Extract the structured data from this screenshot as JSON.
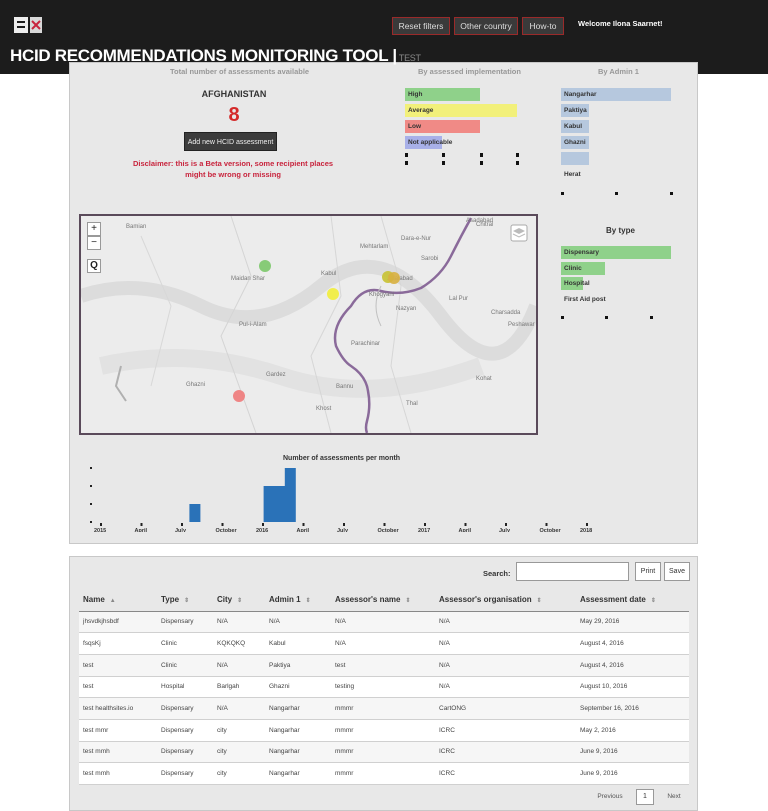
{
  "header": {
    "title": "HCID RECOMMENDATIONS MONITORING TOOL |",
    "title_suffix": "TEST",
    "nav": {
      "reset": "Reset filters",
      "other_country": "Other country",
      "howto": "How-to"
    },
    "welcome": "Welcome Ilona Saarnet!"
  },
  "summary": {
    "country": "AFGHANISTAN",
    "count": "8",
    "add_button": "Add new HCID assessment",
    "disclaimer": "Disclaimer: this is a Beta version, some recipient places might be wrong or missing",
    "faded_left": "Total number of assessments available",
    "faded_mid": "By assessed implementation",
    "faded_right": "By Admin 1"
  },
  "implementation": {
    "bars": [
      {
        "label": "High",
        "value": 2,
        "color": "#8fd18a"
      },
      {
        "label": "Average",
        "value": 3,
        "color": "#f2f07a"
      },
      {
        "label": "Low",
        "value": 2,
        "color": "#f08a86"
      },
      {
        "label": "Not applicable",
        "value": 1,
        "color": "#a8b0e8"
      }
    ]
  },
  "admin1": {
    "bars": [
      {
        "label": "Nangarhar",
        "value": 4,
        "color": "#b6c8de"
      },
      {
        "label": "Paktiya",
        "value": 1,
        "color": "#b6c8de"
      },
      {
        "label": "Kabul",
        "value": 1,
        "color": "#b6c8de"
      },
      {
        "label": "Ghazni",
        "value": 1,
        "color": "#b6c8de"
      },
      {
        "label": "",
        "value": 1,
        "color": "#b6c8de"
      },
      {
        "label": "Herat",
        "value": 0,
        "color": "#b6c8de"
      }
    ]
  },
  "by_type": {
    "title": "By type",
    "bars": [
      {
        "label": "Dispensary",
        "value": 5,
        "color": "#8fd18a"
      },
      {
        "label": "Clinic",
        "value": 2,
        "color": "#8fd18a"
      },
      {
        "label": "Hospital",
        "value": 1,
        "color": "#8fd18a"
      },
      {
        "label": "First Aid post",
        "value": 0,
        "color": "#8fd18a"
      }
    ]
  },
  "map": {
    "places": [
      {
        "name": "Bamian",
        "color": ""
      },
      {
        "name": "Chitral",
        "color": ""
      },
      {
        "name": "Asadabad",
        "color": ""
      },
      {
        "name": "Mehtarlam",
        "color": ""
      },
      {
        "name": "Dara-e-Nur",
        "color": ""
      },
      {
        "name": "Jalalabad",
        "color": ""
      },
      {
        "name": "Maidan Shar",
        "color": ""
      },
      {
        "name": "Khogyani",
        "color": ""
      },
      {
        "name": "Nazyan",
        "color": ""
      },
      {
        "name": "Lal Pur",
        "color": ""
      },
      {
        "name": "Pul-i-Alam",
        "color": ""
      },
      {
        "name": "Parachinar",
        "color": ""
      },
      {
        "name": "Charsadda",
        "color": ""
      },
      {
        "name": "Peshawar",
        "color": ""
      },
      {
        "name": "Ghazni",
        "color": ""
      },
      {
        "name": "Gardez",
        "color": ""
      },
      {
        "name": "Kohat",
        "color": ""
      },
      {
        "name": "Khost",
        "color": ""
      },
      {
        "name": "Thal",
        "color": ""
      },
      {
        "name": "Bannu",
        "color": ""
      },
      {
        "name": "Kabul",
        "color": ""
      },
      {
        "name": "Sarobi",
        "color": ""
      }
    ],
    "markers": [
      {
        "label": "Kabul",
        "color": "#7cc86a"
      },
      {
        "label": "Jalalabad",
        "color": "#c8c232"
      },
      {
        "label": "Nangarhar",
        "color": "#f2ee3a"
      },
      {
        "label": "Ghazni",
        "color": "#f07a7a"
      }
    ],
    "zoom_in": "+",
    "zoom_out": "−",
    "search_glyph": "Q"
  },
  "chart_data": {
    "type": "bar",
    "title": "Number of assessments per month",
    "categories": [
      "2015-Jan",
      "2015-Apr",
      "2015-Jul",
      "2015-Oct",
      "2016-Jan",
      "2016-Apr",
      "2016-May",
      "2016-Jun",
      "2016-Jul",
      "2016-Oct",
      "2017-Jan",
      "2017-Apr",
      "2017-Jul",
      "2017-Oct",
      "2018-Jan"
    ],
    "tick_labels": [
      "2015",
      "April",
      "July",
      "October",
      "2016",
      "April",
      "July",
      "October",
      "2017",
      "April",
      "July",
      "October",
      "2018"
    ],
    "values": [
      0,
      0,
      0,
      1,
      0,
      0,
      2,
      2,
      3,
      0,
      0,
      0,
      0,
      0,
      0
    ],
    "ylim": [
      0,
      3
    ],
    "bar_color": "#2a72b8"
  },
  "table": {
    "search_label": "Search:",
    "search_placeholder": "",
    "print_label": "Print",
    "save_label": "Save",
    "columns": [
      "Name",
      "Type",
      "City",
      "Admin 1",
      "Assessor's name",
      "Assessor's organisation",
      "Assessment date"
    ],
    "rows": [
      [
        "jhsvdkjhsbdf",
        "Dispensary",
        "N/A",
        "N/A",
        "N/A",
        "N/A",
        "May 29, 2016"
      ],
      [
        "fsqsKj",
        "Clinic",
        "KQKQKQ",
        "Kabul",
        "N/A",
        "N/A",
        "August 4, 2016"
      ],
      [
        "test",
        "Clinic",
        "N/A",
        "Paktiya",
        "test",
        "N/A",
        "August 4, 2016"
      ],
      [
        "test",
        "Hospital",
        "Barlgah",
        "Ghazni",
        "testing",
        "N/A",
        "August 10, 2016"
      ],
      [
        "test healthsites.io",
        "Dispensary",
        "N/A",
        "Nangarhar",
        "mmmr",
        "CartONG",
        "September 16, 2016"
      ],
      [
        "test mmr",
        "Dispensary",
        "city",
        "Nangarhar",
        "mmmr",
        "ICRC",
        "May 2, 2016"
      ],
      [
        "test mmh",
        "Dispensary",
        "city",
        "Nangarhar",
        "mmmr",
        "ICRC",
        "June 9, 2016"
      ],
      [
        "test mmh",
        "Dispensary",
        "city",
        "Nangarhar",
        "mmmr",
        "ICRC",
        "June 9, 2016"
      ]
    ],
    "pagination": {
      "previous": "Previous",
      "page": "1",
      "next": "Next"
    }
  }
}
